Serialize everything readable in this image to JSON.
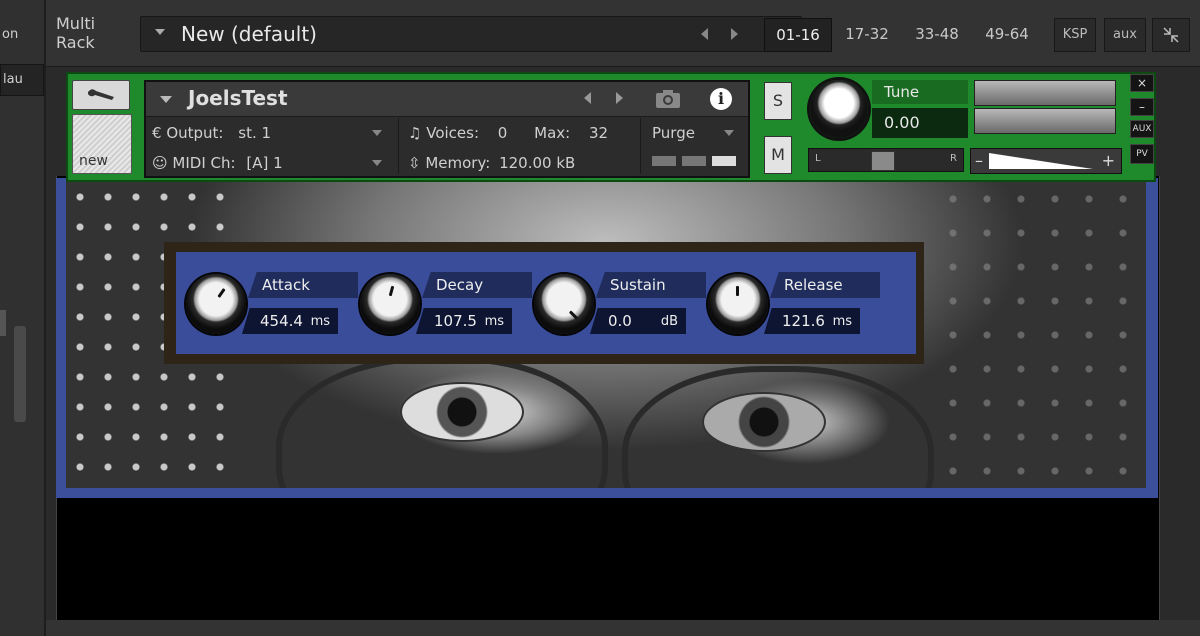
{
  "sidebar": {
    "tab1": "on",
    "tab2": "lau"
  },
  "rack": {
    "title_line1": "Multi",
    "title_line2": "Rack",
    "preset_name": "New (default)",
    "pages": [
      "01-16",
      "17-32",
      "33-48",
      "49-64"
    ],
    "active_page": "01-16",
    "ksp_label": "KSP",
    "aux_label": "aux"
  },
  "instrument": {
    "name": "JoelsTest",
    "output_label": "Output:",
    "output_value": "st. 1",
    "midi_label": "MIDI Ch:",
    "midi_value": "[A]  1",
    "voices_label": "Voices:",
    "voices_value": "0",
    "max_label": "Max:",
    "max_value": "32",
    "memory_label": "Memory:",
    "memory_value": "120.00 kB",
    "purge_label": "Purge",
    "new_label": "new",
    "solo_label": "S",
    "mute_label": "M",
    "tune_label": "Tune",
    "tune_value": "0.00",
    "pan_left": "L",
    "pan_right": "R",
    "vol_minus": "–",
    "vol_plus": "+",
    "side_close": "×",
    "side_min": "–",
    "side_aux": "AUX",
    "side_pv": "PV"
  },
  "adsr": {
    "attack": {
      "label": "Attack",
      "value": "454.4",
      "unit": "ms"
    },
    "decay": {
      "label": "Decay",
      "value": "107.5",
      "unit": "ms"
    },
    "sustain": {
      "label": "Sustain",
      "value": "0.0",
      "unit": "dB"
    },
    "release": {
      "label": "Release",
      "value": "121.6",
      "unit": "ms"
    }
  },
  "colors": {
    "instrument_header": "#1f8a2b",
    "adsr_panel": "#3a4d9a",
    "label_bg": "#1f2c5c",
    "value_bg": "#0d1533"
  },
  "icons": [
    "wrench-icon",
    "camera-icon",
    "info-icon",
    "chevron-left-icon",
    "chevron-right-icon",
    "dropdown-arrow-icon",
    "midi-icon",
    "collapse-icon"
  ]
}
